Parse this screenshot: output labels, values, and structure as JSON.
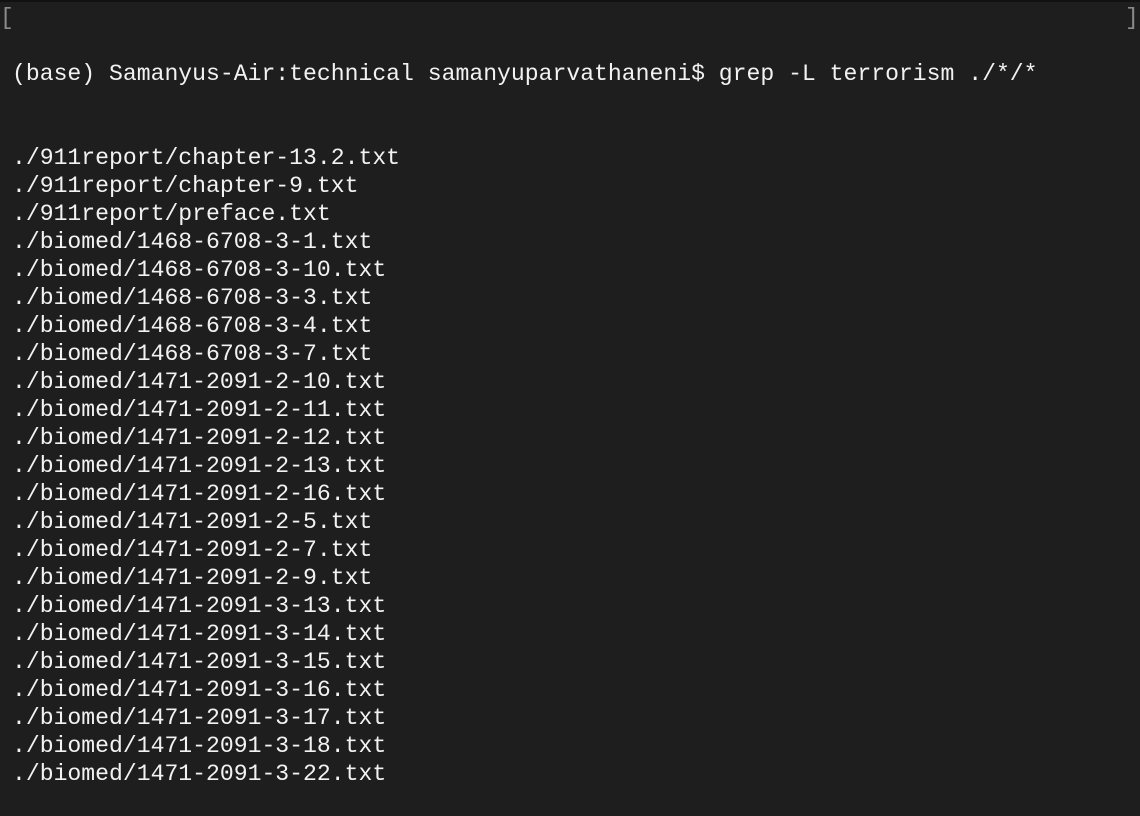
{
  "terminal": {
    "prompt": "(base) Samanyus-Air:technical samanyuparvathaneni$ grep -L terrorism ./*/*",
    "mark_left": "[",
    "mark_right": "]",
    "output": [
      "./911report/chapter-13.2.txt",
      "./911report/chapter-9.txt",
      "./911report/preface.txt",
      "./biomed/1468-6708-3-1.txt",
      "./biomed/1468-6708-3-10.txt",
      "./biomed/1468-6708-3-3.txt",
      "./biomed/1468-6708-3-4.txt",
      "./biomed/1468-6708-3-7.txt",
      "./biomed/1471-2091-2-10.txt",
      "./biomed/1471-2091-2-11.txt",
      "./biomed/1471-2091-2-12.txt",
      "./biomed/1471-2091-2-13.txt",
      "./biomed/1471-2091-2-16.txt",
      "./biomed/1471-2091-2-5.txt",
      "./biomed/1471-2091-2-7.txt",
      "./biomed/1471-2091-2-9.txt",
      "./biomed/1471-2091-3-13.txt",
      "./biomed/1471-2091-3-14.txt",
      "./biomed/1471-2091-3-15.txt",
      "./biomed/1471-2091-3-16.txt",
      "./biomed/1471-2091-3-17.txt",
      "./biomed/1471-2091-3-18.txt",
      "./biomed/1471-2091-3-22.txt"
    ]
  }
}
